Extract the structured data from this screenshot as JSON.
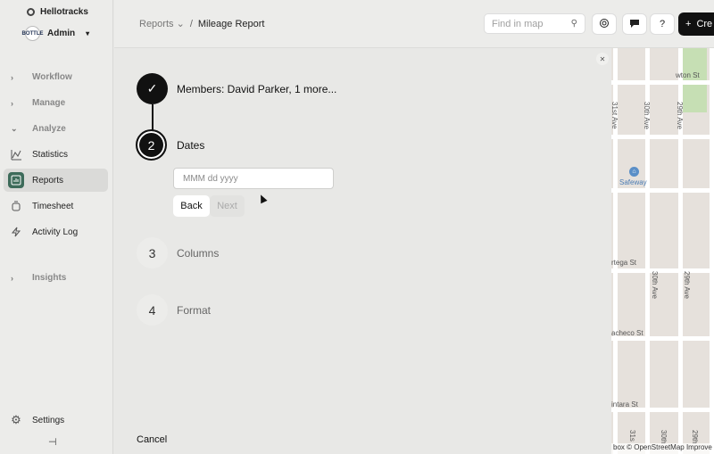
{
  "sidebar": {
    "org_name": "Hellotracks",
    "user_name": "Admin",
    "avatar_text": "BOTTLE",
    "groups": {
      "workflow": "Workflow",
      "manage": "Manage",
      "analyze": "Analyze",
      "insights": "Insights"
    },
    "items": {
      "statistics": "Statistics",
      "reports": "Reports",
      "timesheet": "Timesheet",
      "activity_log": "Activity Log"
    },
    "settings": "Settings"
  },
  "header": {
    "breadcrumb_parent": "Reports",
    "breadcrumb_current": "Mileage Report",
    "search_placeholder": "Find in map",
    "help_label": "?",
    "create_label": "Cre"
  },
  "wizard": {
    "steps": [
      {
        "number": "✓",
        "label": "Members: David Parker, 1 more..."
      },
      {
        "number": "2",
        "label": "Dates"
      },
      {
        "number": "3",
        "label": "Columns"
      },
      {
        "number": "4",
        "label": "Format"
      }
    ],
    "date_placeholder": "MMM dd yyyy",
    "back_label": "Back",
    "next_label": "Next",
    "cancel_label": "Cancel"
  },
  "map": {
    "labels": {
      "ave31": "31st Ave",
      "ave30_top": "30th Ave",
      "ave29_top": "29th Ave",
      "safeway": "Safeway",
      "ortega": "rtega St",
      "ave30_mid": "30th Ave",
      "ave29_mid": "29th Ave",
      "pacheco": "acheco St",
      "quintara": "intara St",
      "ave31_bot": "31s",
      "ave30_bot": "30th",
      "ave29_bot": "29th",
      "polk_top": "wton St"
    },
    "attribution": "box © OpenStreetMap Improve"
  },
  "colors": {
    "accent": "#3d6b5a",
    "primary": "#111111"
  }
}
